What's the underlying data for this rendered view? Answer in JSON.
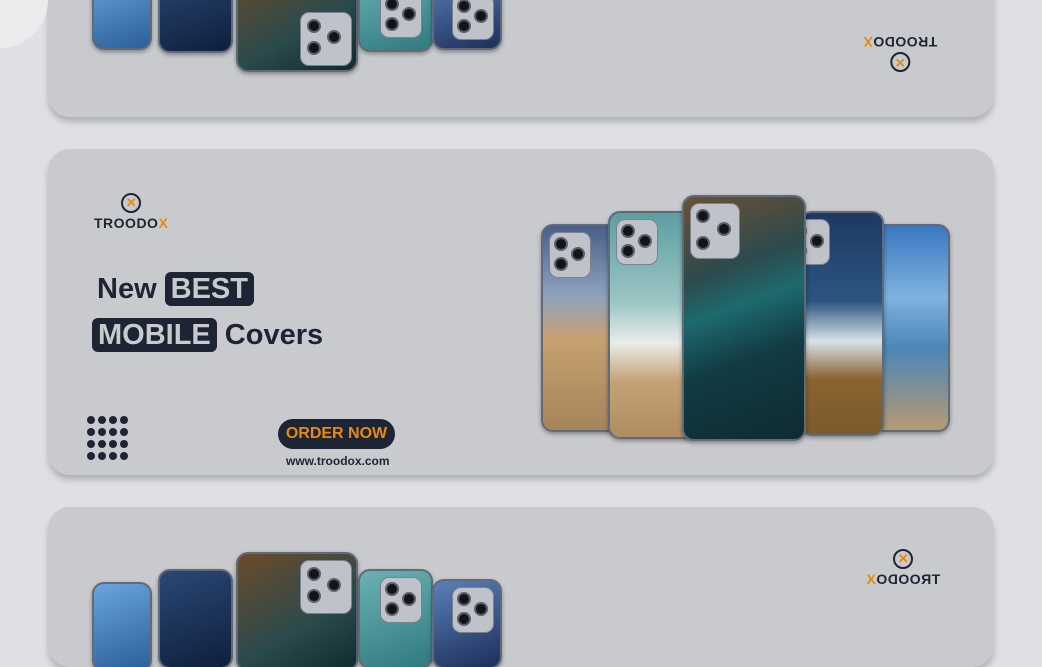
{
  "brand": {
    "name_main": "TROODO",
    "name_x": "X",
    "mark": "✕"
  },
  "banner": {
    "headline_new": "New",
    "headline_best": "BEST",
    "headline_mobile": "MOBILE",
    "headline_covers": "Covers",
    "cta": "ORDER NOW",
    "url": "www.troodox.com"
  },
  "colors": {
    "accent": "#e88a0b",
    "dark": "#1d2433",
    "card": "#c9cacd",
    "background": "#dfe0e3"
  }
}
